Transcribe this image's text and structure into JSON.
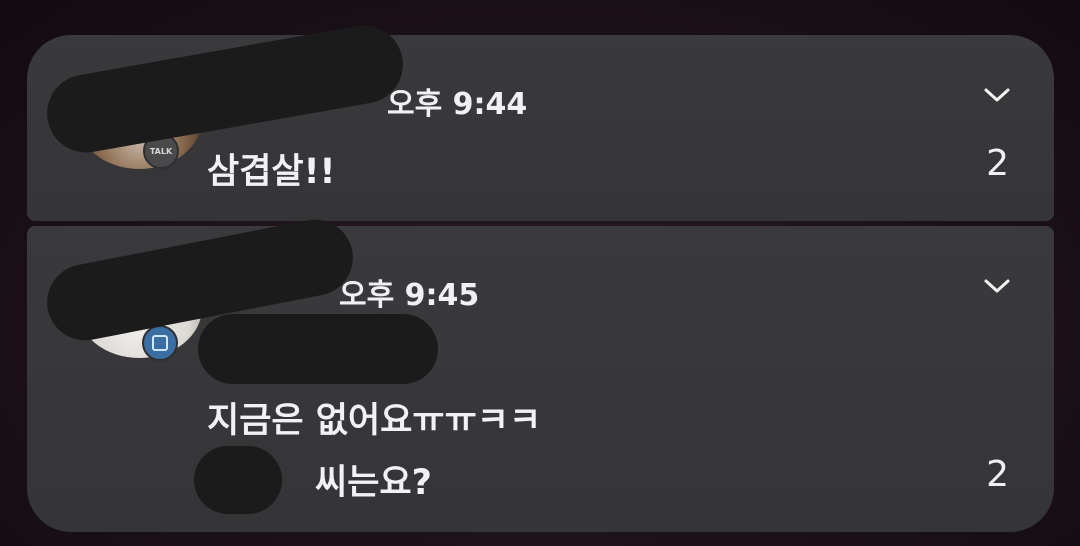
{
  "notifications": [
    {
      "time": "오후 9:44",
      "message_lines": [
        "삼겹살!!"
      ],
      "count": "2",
      "app_badge": "TALK"
    },
    {
      "time": "오후 9:45",
      "message_lines": [
        "지금은 없어요ㅠㅠㅋㅋ",
        "씨는요?"
      ],
      "count": "2",
      "app_badge": ""
    }
  ],
  "icons": {
    "expand": "chevron-down-icon"
  }
}
